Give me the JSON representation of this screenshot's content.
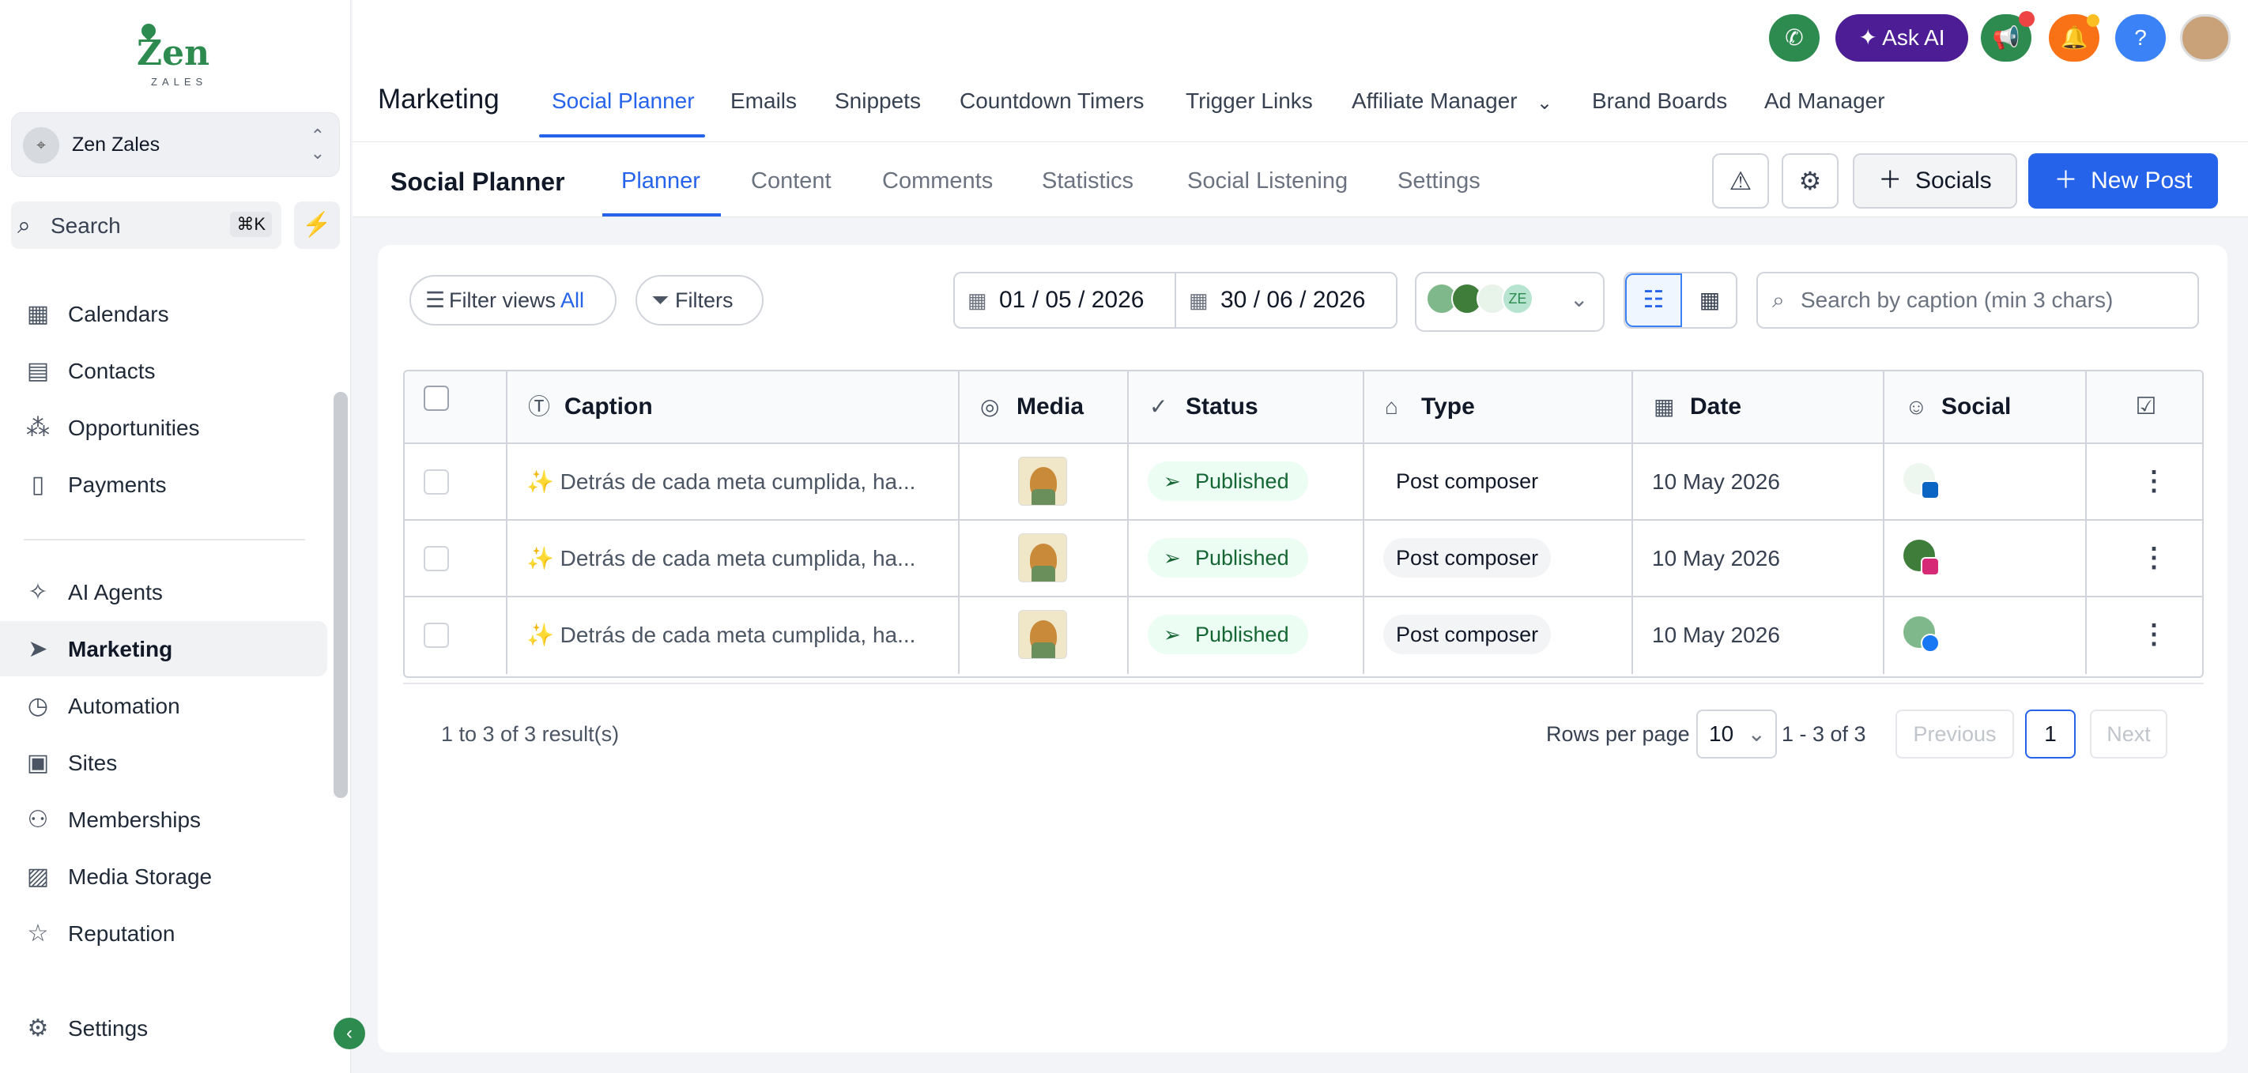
{
  "sidebar": {
    "logo_text": "Zen",
    "logo_sub": "ZALES",
    "account_name": "Zen Zales",
    "search_label": "Search",
    "search_shortcut": "⌘K",
    "items": [
      {
        "label": "Calendars"
      },
      {
        "label": "Contacts"
      },
      {
        "label": "Opportunities"
      },
      {
        "label": "Payments"
      },
      {
        "label": "AI Agents"
      },
      {
        "label": "Marketing"
      },
      {
        "label": "Automation"
      },
      {
        "label": "Sites"
      },
      {
        "label": "Memberships"
      },
      {
        "label": "Media Storage"
      },
      {
        "label": "Reputation"
      }
    ],
    "settings_label": "Settings"
  },
  "header": {
    "title": "Marketing",
    "tabs": [
      {
        "label": "Social Planner"
      },
      {
        "label": "Emails"
      },
      {
        "label": "Snippets"
      },
      {
        "label": "Countdown Timers"
      },
      {
        "label": "Trigger Links"
      },
      {
        "label": "Affiliate Manager"
      },
      {
        "label": "Brand Boards"
      },
      {
        "label": "Ad Manager"
      }
    ],
    "ask_ai_label": "Ask AI",
    "help_label": "?"
  },
  "subheader": {
    "title": "Social Planner",
    "tabs": [
      {
        "label": "Planner"
      },
      {
        "label": "Content"
      },
      {
        "label": "Comments"
      },
      {
        "label": "Statistics"
      },
      {
        "label": "Social Listening"
      },
      {
        "label": "Settings"
      }
    ],
    "socials_label": "Socials",
    "new_post_label": "New Post"
  },
  "toolbar": {
    "filter_views_label": "Filter views",
    "filter_views_value": "All",
    "filters_label": "Filters",
    "date_from": "01 / 05 / 2026",
    "date_to": "30 / 06 / 2026",
    "account_initials": "ZE",
    "search_placeholder": "Search by caption (min 3 chars)"
  },
  "table": {
    "columns": [
      "Caption",
      "Media",
      "Status",
      "Type",
      "Date",
      "Social"
    ],
    "rows": [
      {
        "caption": "✨ Detrás de cada meta cumplida, ha...",
        "status": "Published",
        "type": "Post composer",
        "date": "10 May 2026",
        "social": "linkedin"
      },
      {
        "caption": "✨ Detrás de cada meta cumplida, ha...",
        "status": "Published",
        "type": "Post composer",
        "date": "10 May 2026",
        "social": "instagram"
      },
      {
        "caption": "✨ Detrás de cada meta cumplida, ha...",
        "status": "Published",
        "type": "Post composer",
        "date": "10 May 2026",
        "social": "facebook"
      }
    ]
  },
  "pagination": {
    "results": "1 to 3 of 3 result(s)",
    "rows_per_page_label": "Rows per page",
    "rows_per_page": "10",
    "range": "1 - 3 of 3",
    "previous": "Previous",
    "current_page": "1",
    "next": "Next"
  },
  "colors": {
    "accent": "#2563eb",
    "brand_green": "#2e8b4f",
    "ask_ai": "#4c1d95",
    "published_bg": "#ecfdf3"
  }
}
